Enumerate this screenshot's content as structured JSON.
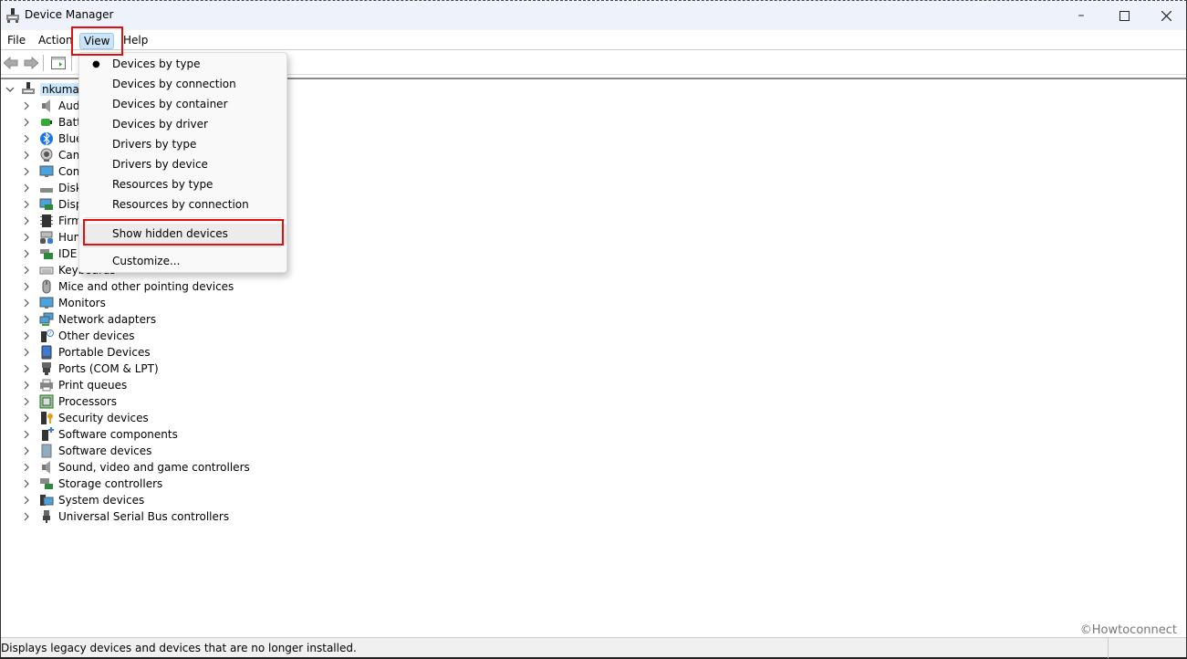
{
  "window": {
    "title": "Device Manager",
    "controls": [
      "minimize",
      "maximize",
      "close"
    ]
  },
  "menubar": {
    "items": [
      {
        "label": "File"
      },
      {
        "label": "Action"
      },
      {
        "label": "View",
        "active": true
      },
      {
        "label": "Help"
      }
    ]
  },
  "toolbar": {
    "buttons": [
      "back-arrow-icon",
      "forward-arrow-icon",
      "show-hide-console-tree-icon"
    ]
  },
  "view_menu": {
    "items": [
      {
        "label": "Devices by type",
        "checked": true
      },
      {
        "label": "Devices by connection"
      },
      {
        "label": "Devices by container"
      },
      {
        "label": "Devices by driver"
      },
      {
        "label": "Drivers by type"
      },
      {
        "label": "Drivers by device"
      },
      {
        "label": "Resources by type"
      },
      {
        "label": "Resources by connection"
      },
      {
        "label": "Show hidden devices",
        "highlighted": true
      },
      {
        "label": "Customize..."
      }
    ]
  },
  "tree": {
    "root": {
      "label": "nkumar",
      "icon": "computer-icon",
      "expanded": true
    },
    "categories": [
      {
        "label": "Audio inputs and outputs",
        "icon": "speaker-icon"
      },
      {
        "label": "Batteries",
        "icon": "battery-icon"
      },
      {
        "label": "Bluetooth",
        "icon": "bluetooth-icon"
      },
      {
        "label": "Cameras",
        "icon": "camera-icon"
      },
      {
        "label": "Computer",
        "icon": "monitor-icon"
      },
      {
        "label": "Disk drives",
        "icon": "disk-drive-icon"
      },
      {
        "label": "Display adapters",
        "icon": "display-adapter-icon"
      },
      {
        "label": "Firmware",
        "icon": "chip-icon"
      },
      {
        "label": "Human Interface Devices",
        "icon": "hid-icon"
      },
      {
        "label": "IDE ATA/ATAPI controllers",
        "icon": "ide-controller-icon"
      },
      {
        "label": "Keyboards",
        "icon": "keyboard-icon"
      },
      {
        "label": "Mice and other pointing devices",
        "icon": "mouse-icon"
      },
      {
        "label": "Monitors",
        "icon": "monitor-icon"
      },
      {
        "label": "Network adapters",
        "icon": "network-adapter-icon"
      },
      {
        "label": "Other devices",
        "icon": "unknown-device-icon"
      },
      {
        "label": "Portable Devices",
        "icon": "portable-device-icon"
      },
      {
        "label": "Ports (COM & LPT)",
        "icon": "port-icon"
      },
      {
        "label": "Print queues",
        "icon": "printer-icon"
      },
      {
        "label": "Processors",
        "icon": "processor-icon"
      },
      {
        "label": "Security devices",
        "icon": "security-key-icon"
      },
      {
        "label": "Software components",
        "icon": "software-component-icon"
      },
      {
        "label": "Software devices",
        "icon": "software-device-icon"
      },
      {
        "label": "Sound, video and game controllers",
        "icon": "speaker-icon"
      },
      {
        "label": "Storage controllers",
        "icon": "storage-controller-icon"
      },
      {
        "label": "System devices",
        "icon": "system-devices-icon"
      },
      {
        "label": "Universal Serial Bus controllers",
        "icon": "usb-icon"
      }
    ]
  },
  "statusbar": {
    "message": "Displays legacy devices and devices that are no longer installed."
  },
  "watermark": "©Howtoconnect",
  "colors": {
    "highlight_box": "#e01010",
    "menu_active": "#cce4f7",
    "titlebar_bg": "#eef2fa"
  }
}
